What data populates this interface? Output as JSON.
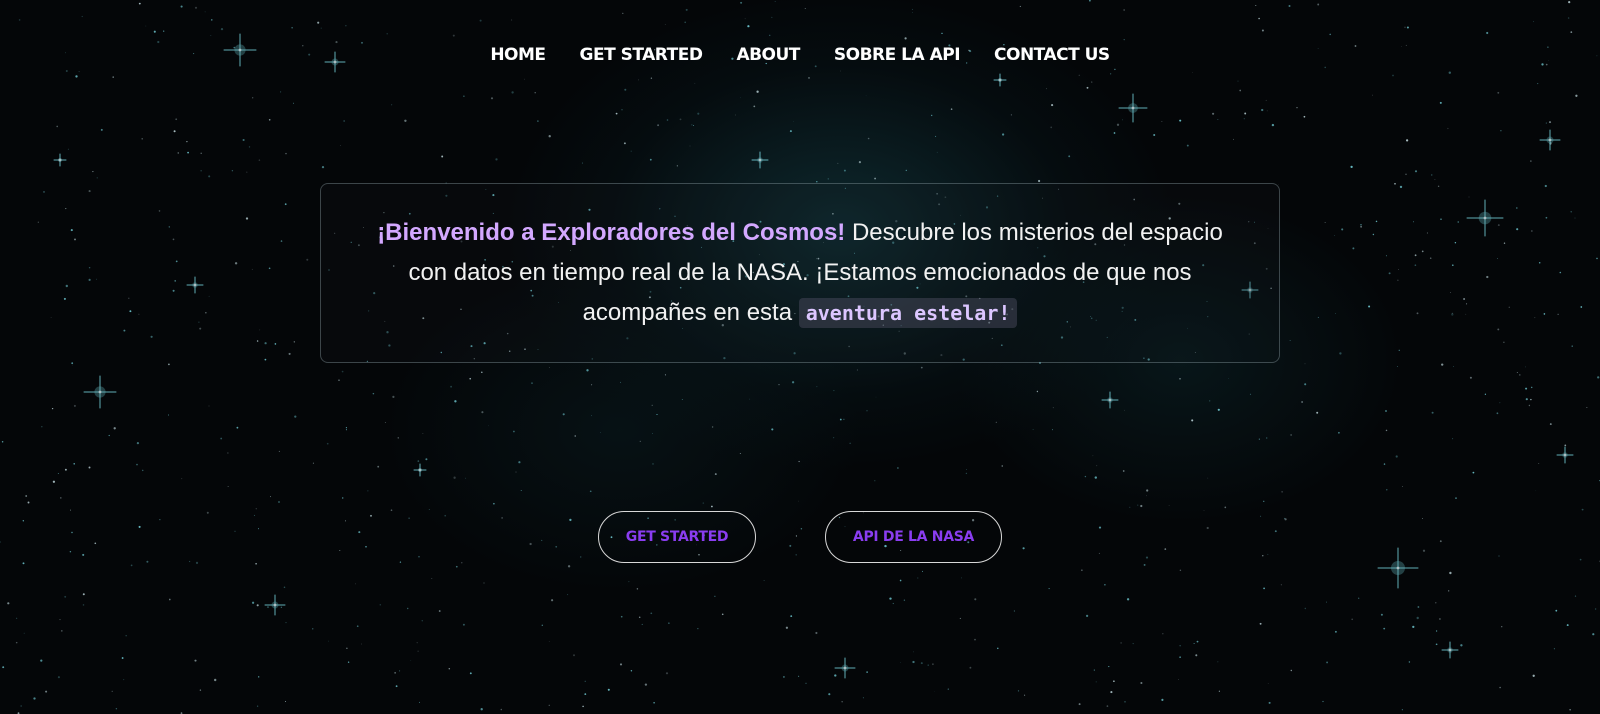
{
  "nav": {
    "items": [
      {
        "label": "HOME"
      },
      {
        "label": "GET STARTED"
      },
      {
        "label": "ABOUT"
      },
      {
        "label": "SOBRE LA API"
      },
      {
        "label": "CONTACT US"
      }
    ]
  },
  "welcome": {
    "strong": "¡Bienvenido a Exploradores del Cosmos!",
    "body": " Descubre los misterios del espacio con datos en tiempo real de la NASA. ¡Estamos emocionados de que nos acompañes en esta ",
    "code": "aventura estelar!"
  },
  "buttons": {
    "get_started": "GET STARTED",
    "nasa_api": "API DE LA NASA"
  },
  "colors": {
    "background": "#040608",
    "nebula": "#16464e",
    "accent_purple": "#8a3df0",
    "highlight_purple": "#d3a8ff",
    "star_cyan": "#7fe6f0"
  }
}
